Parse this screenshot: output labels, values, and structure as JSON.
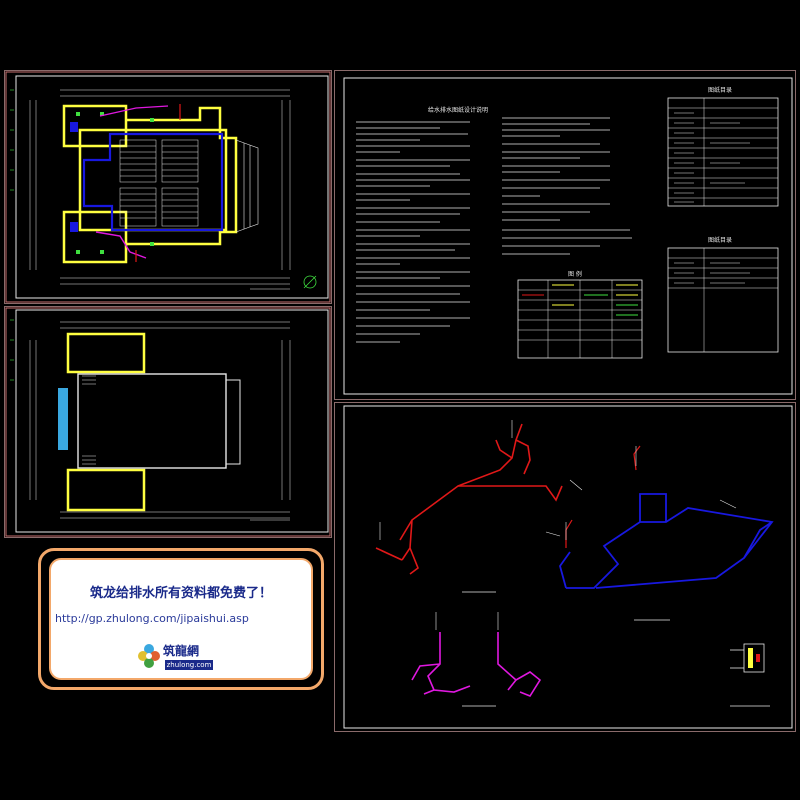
{
  "banner": {
    "title": "筑龙给排水所有资料都免费了！",
    "url": "http://gp.zhulong.com/jipaishui.asp",
    "logo_text": "筑龍網",
    "logo_sub": "zhulong.com"
  },
  "drawings": {
    "notes_sheet_title": "给水排水图纸设计说明",
    "drawing_list_title": "图纸目录",
    "legend_title": "图  例",
    "index_title": "图纸目录"
  },
  "colors": {
    "background": "#000000",
    "frame": "#e8e8e8",
    "outer_frame": "#8a6a6a",
    "water_supply": "#e01818",
    "drainage": "#1818e0",
    "hot_water": "#e018e0",
    "wall": "#ffff40",
    "dimension": "#40e040",
    "banner_border": "#f3a86a"
  }
}
